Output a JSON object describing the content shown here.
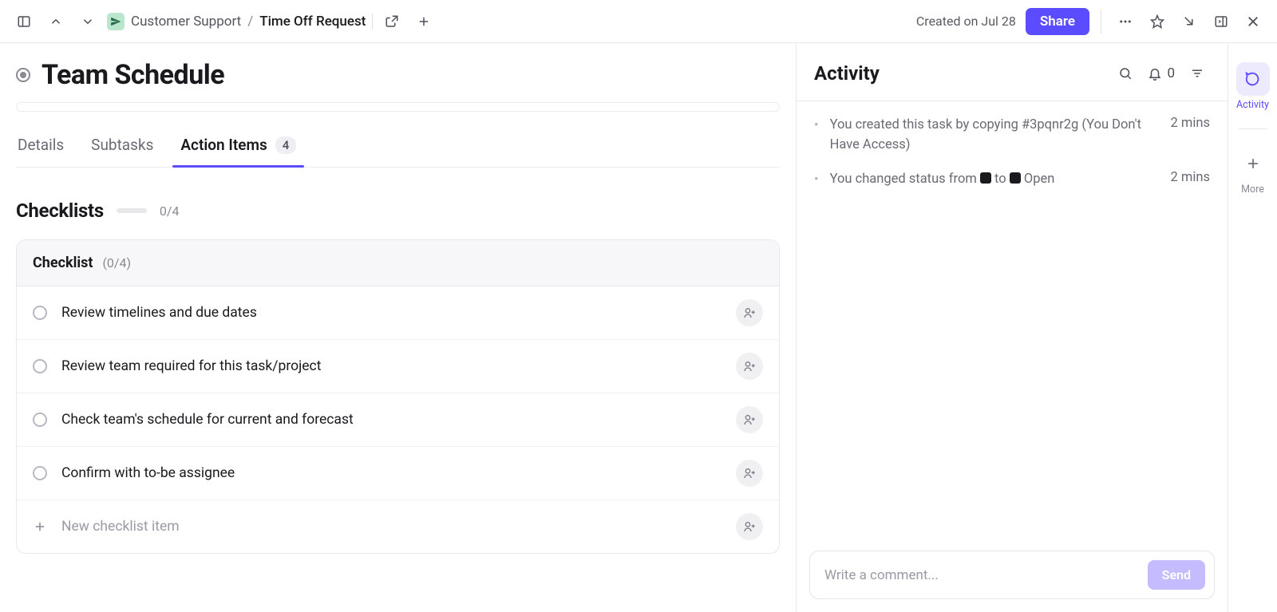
{
  "topbar": {
    "breadcrumb": {
      "space": "Customer Support",
      "page": "Time Off Request"
    },
    "created_text": "Created on Jul 28",
    "share_label": "Share"
  },
  "task": {
    "title": "Team Schedule"
  },
  "tabs": {
    "details": "Details",
    "subtasks": "Subtasks",
    "action_items_label": "Action Items",
    "action_items_count": "4"
  },
  "checklists": {
    "section_title": "Checklists",
    "overall_progress": "0/4",
    "card_title": "Checklist",
    "card_count": "(0/4)",
    "items": [
      "Review timelines and due dates",
      "Review team required for this task/project",
      "Check team's schedule for current and forecast",
      "Confirm with to-be assignee"
    ],
    "new_item_placeholder": "New checklist item"
  },
  "activity": {
    "title": "Activity",
    "notif_count": "0",
    "feed": [
      {
        "text_pre": "You created this task by copying #3pqnr2g (You Don't Have Access)",
        "time": "2 mins",
        "type": "plain"
      },
      {
        "text_pre": "You changed status from ",
        "text_mid": " to ",
        "text_post": " Open",
        "time": "2 mins",
        "type": "status"
      }
    ],
    "comment_placeholder": "Write a comment...",
    "send_label": "Send"
  },
  "rail": {
    "activity_label": "Activity",
    "more_label": "More"
  }
}
